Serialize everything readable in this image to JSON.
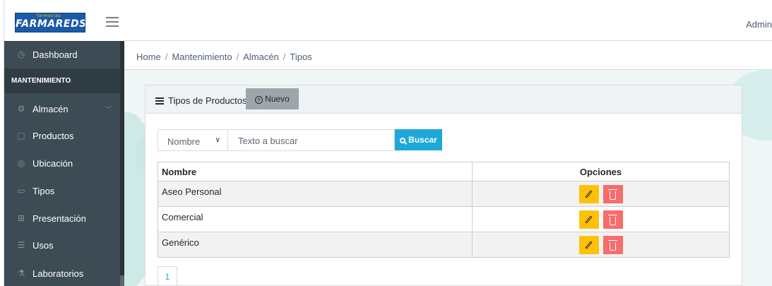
{
  "header": {
    "logo_text": "FARMAREDS",
    "logo_subtext": "farmacias",
    "user_label": "Admin"
  },
  "sidebar": {
    "items": [
      {
        "label": "Dashboard",
        "icon": "speedometer-icon"
      },
      {
        "label": "Almacén",
        "icon": "gears-icon",
        "expandable": true
      },
      {
        "label": "Productos",
        "icon": "box-icon"
      },
      {
        "label": "Ubicación",
        "icon": "location-pin-icon"
      },
      {
        "label": "Tipos",
        "icon": "folder-icon"
      },
      {
        "label": "Presentación",
        "icon": "gift-icon"
      },
      {
        "label": "Usos",
        "icon": "list-icon"
      },
      {
        "label": "Laboratorios",
        "icon": "flask-icon"
      }
    ],
    "section_title": "MANTENIMIENTO"
  },
  "breadcrumb": [
    "Home",
    "Mantenimiento",
    "Almacén",
    "Tipos"
  ],
  "card": {
    "title": "Tipos de Productos",
    "new_button_label": "Nuevo"
  },
  "search": {
    "select_value": "Nombre",
    "placeholder": "Texto a buscar",
    "button_label": "Buscar"
  },
  "table": {
    "columns": [
      "Nombre",
      "Opciones"
    ],
    "rows": [
      {
        "name": "Aseo Personal"
      },
      {
        "name": "Comercial"
      },
      {
        "name": "Genérico"
      }
    ]
  },
  "pagination": {
    "current_page": "1"
  },
  "colors": {
    "sidebar_bg": "#3c4b54",
    "edit_button": "#ffc107",
    "delete_button": "#f86c6b",
    "search_button": "#1da8d9",
    "new_button": "#9fa6ab"
  }
}
